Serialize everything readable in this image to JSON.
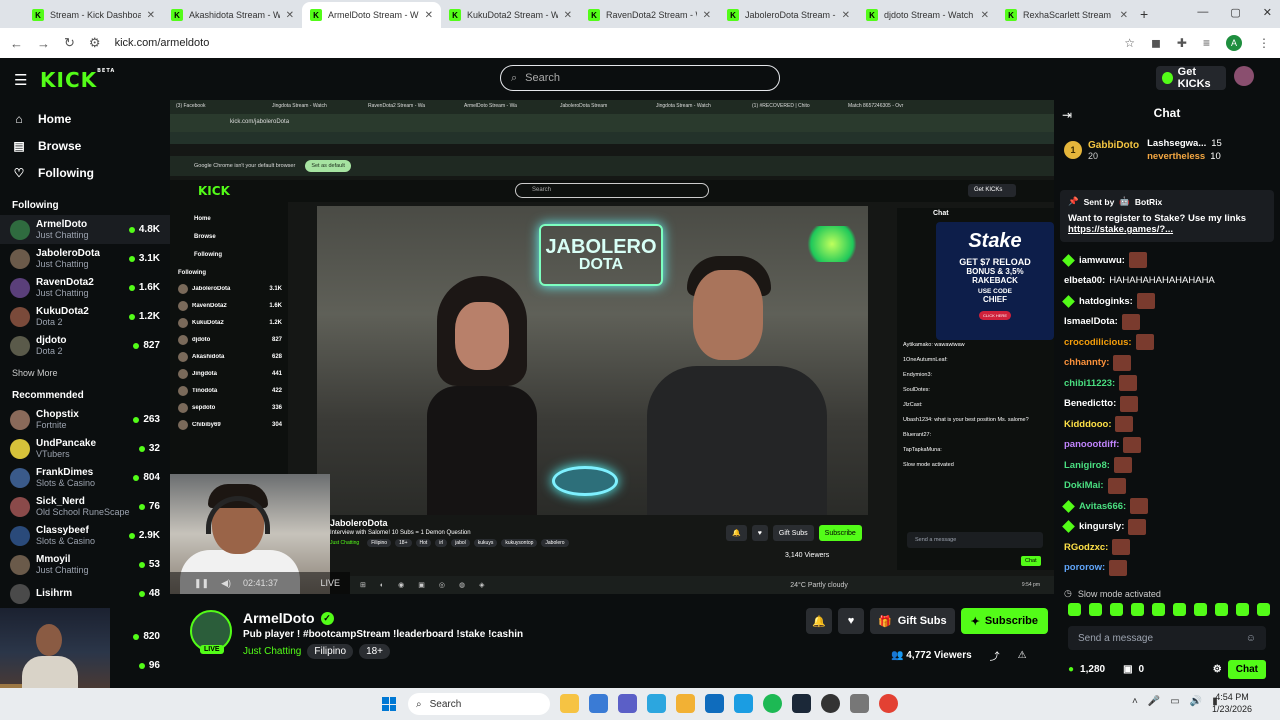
{
  "browser": {
    "tabs": [
      {
        "title": "Stream - Kick Dashboard",
        "active": false
      },
      {
        "title": "Akashidota Stream - Watc",
        "active": false
      },
      {
        "title": "ArmelDoto Stream - W",
        "active": true
      },
      {
        "title": "KukuDota2 Stream - Watc",
        "active": false
      },
      {
        "title": "RavenDota2 Stream - Wat",
        "active": false
      },
      {
        "title": "JaboleroDota Stream - W",
        "active": false
      },
      {
        "title": "djdoto Stream - Watch Li",
        "active": false
      },
      {
        "title": "RexhaScarlett Stream",
        "active": false
      }
    ],
    "url": "kick.com/armeldoto",
    "profile_initial": "A"
  },
  "header": {
    "logo": "KICK",
    "logo_sup": "BETA",
    "search_placeholder": "Search",
    "get_kicks": "Get KICKs"
  },
  "sidebar": {
    "nav": [
      {
        "label": "Home",
        "icon": "home-icon"
      },
      {
        "label": "Browse",
        "icon": "browse-icon"
      },
      {
        "label": "Following",
        "icon": "heart-icon"
      }
    ],
    "following_title": "Following",
    "following": [
      {
        "name": "ArmelDoto",
        "category": "Just Chatting",
        "viewers": "4.8K",
        "color": "#2f6b3f"
      },
      {
        "name": "JaboleroDota",
        "category": "Just Chatting",
        "viewers": "3.1K",
        "color": "#6b5a4a"
      },
      {
        "name": "RavenDota2",
        "category": "Just Chatting",
        "viewers": "1.6K",
        "color": "#5a3f7a"
      },
      {
        "name": "KukuDota2",
        "category": "Dota 2",
        "viewers": "1.2K",
        "color": "#7a4a3a"
      },
      {
        "name": "djdoto",
        "category": "Dota 2",
        "viewers": "827",
        "color": "#5a5a4a"
      }
    ],
    "show_more": "Show More",
    "recommended_title": "Recommended",
    "recommended": [
      {
        "name": "Chopstix",
        "category": "Fortnite",
        "viewers": "263",
        "color": "#8a6a5a"
      },
      {
        "name": "UndPancake",
        "category": "VTubers",
        "viewers": "32",
        "color": "#d6c23a"
      },
      {
        "name": "FrankDimes",
        "category": "Slots & Casino",
        "viewers": "804",
        "color": "#3a5a8a"
      },
      {
        "name": "Sick_Nerd",
        "category": "Old School RuneScape",
        "viewers": "76",
        "color": "#8a4a4a"
      },
      {
        "name": "Classybeef",
        "category": "Slots & Casino",
        "viewers": "2.9K",
        "color": "#2a4a7a"
      },
      {
        "name": "Mmoyil",
        "category": "Just Chatting",
        "viewers": "53",
        "color": "#6a5a4a"
      },
      {
        "name": "Lisihrm",
        "category": "",
        "viewers": "48",
        "color": "#4a4a4a"
      }
    ],
    "extra_counts": [
      "820",
      "96"
    ]
  },
  "inner": {
    "tabs": [
      "(3) Facebook",
      "Jingdota Stream - Watch",
      "RavenDota2 Stream - Wa",
      "ArmelDoto Stream - Wa",
      "JaboleroDota Stream",
      "Jingdota Stream - Watch",
      "(1) #RECOVERED | Chito",
      "Match 8657246305 - Ovr"
    ],
    "url": "kick.com/jaboleroDota",
    "banner": "Google Chrome isn't your default browser",
    "banner_btn": "Set as default",
    "search": "Search",
    "get_kicks": "Get KICKs",
    "nav": [
      "Home",
      "Browse",
      "Following"
    ],
    "following_title": "Following",
    "following": [
      {
        "name": "JaboleroDota",
        "viewers": "3.1K"
      },
      {
        "name": "RavenDota2",
        "viewers": "1.6K"
      },
      {
        "name": "KukuDota2",
        "viewers": "1.2K"
      },
      {
        "name": "djdoto",
        "viewers": "827"
      },
      {
        "name": "Akashidota",
        "viewers": "628"
      },
      {
        "name": "Jingdota",
        "viewers": "441"
      },
      {
        "name": "Tinodota",
        "viewers": "422"
      },
      {
        "name": "sepdoto",
        "viewers": "336"
      },
      {
        "name": "Chibiby69",
        "viewers": "304"
      }
    ],
    "neon_line1": "JABOLERO",
    "neon_line2": "DOTA",
    "streamer": "JaboleroDota",
    "stream_title": "Interview with Salome! 10 Subs = 1 Demon Question",
    "tags": [
      "Just Chatting",
      "Filipino",
      "18+",
      "Hot",
      "irl",
      "jabol",
      "kukuys",
      "kukuysontop",
      "Jabolero"
    ],
    "gift_subs": "Gift Subs",
    "subscribe": "Subscribe",
    "viewers": "3,140 Viewers",
    "chat_title": "Chat",
    "chat_lines": [
      "Aytikamako: wawawiwaw",
      "1OneAutumnLeaf:",
      "Endymion3:",
      "SoulDotes:",
      "JlzCast:",
      "Ubash1234: what is your best position Ms. salome?",
      "Bluerant27:",
      "TapTapkaMuna:",
      "Slow mode activated"
    ],
    "ad": {
      "brand": "Stake",
      "l1": "GET $7 RELOAD",
      "l2": "BONUS & 3,5%",
      "l3": "RAKEBACK",
      "l4": "USE CODE",
      "l5": "CHIEF",
      "click": "CLICK HERE"
    },
    "send_placeholder": "Send a message",
    "chat_btn": "Chat",
    "player_time": "02:41:37",
    "player_live": "LIVE",
    "weather": "24°C Partly cloudy",
    "inner_time": "9:54 pm"
  },
  "stream": {
    "name": "ArmelDoto",
    "title": "Pub player ! #bootcampStream !leaderboard !stake !cashin",
    "category": "Just Chatting",
    "tags": [
      "Filipino",
      "18+"
    ],
    "live": "LIVE",
    "gift_subs": "Gift Subs",
    "subscribe": "Subscribe",
    "viewers": "4,772 Viewers"
  },
  "chat": {
    "title": "Chat",
    "top_gifter": {
      "rank": "1",
      "name": "GabbiDoto",
      "count": "20"
    },
    "gifters": [
      {
        "name": "Lashsegwa...",
        "count": "15"
      },
      {
        "name": "nevertheless",
        "count": "10"
      }
    ],
    "pinned": {
      "sender_label": "Sent by",
      "sender": "BotRix",
      "text": "Want to register to Stake? Use my links",
      "link": "https://stake.games/?..."
    },
    "messages": [
      {
        "user": "iamwuwu:",
        "text": "",
        "color": "#ffffff",
        "badge": true,
        "emote": true
      },
      {
        "user": "elbeta00:",
        "text": "HAHAHAHAHAHAHAHA",
        "color": "#ffffff",
        "badge": false,
        "emote": false
      },
      {
        "user": "hatdoginks:",
        "text": "",
        "color": "#ffffff",
        "badge": true,
        "emote": true
      },
      {
        "user": "IsmaelDota:",
        "text": "",
        "color": "#ffffff",
        "badge": false,
        "emote": true
      },
      {
        "user": "crocodilicious:",
        "text": "",
        "color": "#f59e0b",
        "badge": false,
        "emote": true
      },
      {
        "user": "chhannty:",
        "text": "",
        "color": "#fb923c",
        "badge": false,
        "emote": true
      },
      {
        "user": "chibi11223:",
        "text": "",
        "color": "#4ade80",
        "badge": false,
        "emote": true
      },
      {
        "user": "Benedictto:",
        "text": "",
        "color": "#ffffff",
        "badge": false,
        "emote": true
      },
      {
        "user": "Kidddooo:",
        "text": "",
        "color": "#fde047",
        "badge": false,
        "emote": true
      },
      {
        "user": "panoootdiff:",
        "text": "",
        "color": "#c084fc",
        "badge": false,
        "emote": true
      },
      {
        "user": "Lanigiro8:",
        "text": "",
        "color": "#4ade80",
        "badge": false,
        "emote": true
      },
      {
        "user": "DokiMai:",
        "text": "",
        "color": "#4ade80",
        "badge": false,
        "emote": true
      },
      {
        "user": "Avitas666:",
        "text": "",
        "color": "#4ade80",
        "badge": true,
        "emote": true
      },
      {
        "user": "kingursly:",
        "text": "",
        "color": "#ffffff",
        "badge": true,
        "emote": true
      },
      {
        "user": "RGodzxc:",
        "text": "",
        "color": "#fde047",
        "badge": false,
        "emote": true
      },
      {
        "user": "pororow:",
        "text": "",
        "color": "#60a5fa",
        "badge": false,
        "emote": true
      }
    ],
    "slow_mode": "Slow mode activated",
    "send_placeholder": "Send a message",
    "points": "1,280",
    "gifts": "0",
    "chat_button": "Chat"
  },
  "taskbar": {
    "search": "Search",
    "time": "4:54 PM",
    "date": "1/23/2026"
  }
}
